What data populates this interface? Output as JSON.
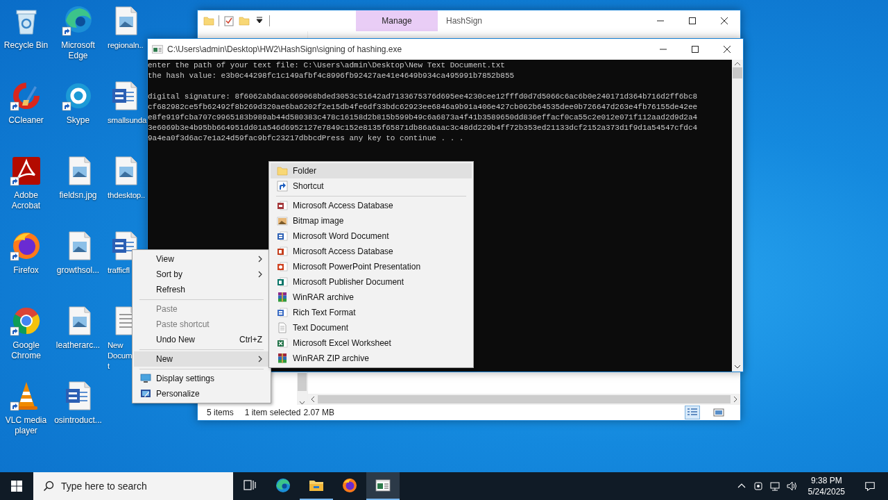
{
  "desktop_columns": [
    {
      "icons": [
        {
          "label": "Recycle Bin",
          "kind": "recycle",
          "shortcut": false
        },
        {
          "label": "CCleaner",
          "kind": "ccleaner",
          "shortcut": true
        },
        {
          "label": "Adobe\nAcrobat",
          "kind": "acrobat",
          "shortcut": true
        },
        {
          "label": "Firefox",
          "kind": "firefox",
          "shortcut": true
        },
        {
          "label": "Google\nChrome",
          "kind": "chrome",
          "shortcut": true
        },
        {
          "label": "VLC media\nplayer",
          "kind": "vlc",
          "shortcut": true
        }
      ]
    },
    {
      "icons": [
        {
          "label": "Microsoft\nEdge",
          "kind": "edge",
          "shortcut": true
        },
        {
          "label": "Skype",
          "kind": "skype",
          "shortcut": true
        },
        {
          "label": "fieldsn.jpg",
          "kind": "image",
          "shortcut": false
        },
        {
          "label": "growthsol...",
          "kind": "image",
          "shortcut": false
        },
        {
          "label": "leatherarc...",
          "kind": "image",
          "shortcut": false
        },
        {
          "label": "osintroduct...",
          "kind": "word",
          "shortcut": false
        }
      ]
    },
    {
      "icons": [
        {
          "label": "regionaln..",
          "kind": "image",
          "shortcut": false
        },
        {
          "label": "smallsunda",
          "kind": "word",
          "shortcut": false
        },
        {
          "label": "thdesktop..",
          "kind": "image",
          "shortcut": false
        },
        {
          "label": "trafficfl",
          "kind": "word",
          "shortcut": false
        },
        {
          "label": "New\nDocum\nt",
          "kind": "text",
          "shortcut": false
        }
      ]
    }
  ],
  "explorer": {
    "context_tab": "Manage",
    "title": "HashSign",
    "status_bar": {
      "item_count": "5 items",
      "selection": "1 item selected",
      "size": "2.07 MB"
    },
    "view_buttons": [
      {
        "kind": "details",
        "selected": true
      },
      {
        "kind": "preview",
        "selected": false
      }
    ]
  },
  "console": {
    "title": "C:\\Users\\admin\\Desktop\\HW2\\HashSign\\signing of hashing.exe",
    "input_lines": [
      "enter the path of your text file: C:\\Users\\admin\\Desktop\\New Text Document.txt",
      "the hash value: e3b0c44298fc1c149afbf4c8996fb92427ae41e4649b934ca495991b7852b855"
    ],
    "signature_lines": [
      "digital signature: 8f6062abdaac669068bded3053c51642ad7133675376d695ee4230cee12fffd0d7d5066c6ac6b0e240171d364b716d2ff6bc8",
      "cf682982ce5fb62492f8b269d320ae6ba6202f2e15db4fe6df33bdc62923ee6846a9b91a406e427cb062b64535dee0b726647d263e4fb76155de42ee",
      "e8fe919fcba707c9965183b989ab44d580383c478c16158d2b815b599b49c6a6873a4f41b3589650dd836effacf0ca55c2e012e071f112aad2d9d2a4",
      "3e6069b3e4b95bb664951dd01a546d6952127e7849c152e8135f65871db86a6aac3c48dd229b4ff72b353ed21133dcf2152a373d1f9d1a54547cfdc4",
      "9a4ea0f3d6ac7e1a24d59fac9bfc23217dbbcdPress any key to continue . . ."
    ]
  },
  "context_menu": {
    "items": [
      {
        "kind": "item",
        "label": "View",
        "has_submenu": true,
        "disabled": false,
        "selected": false
      },
      {
        "kind": "item",
        "label": "Sort by",
        "has_submenu": true,
        "disabled": false,
        "selected": false
      },
      {
        "kind": "item",
        "label": "Refresh",
        "has_submenu": false,
        "disabled": false,
        "selected": false
      },
      {
        "kind": "separator"
      },
      {
        "kind": "item",
        "label": "Paste",
        "has_submenu": false,
        "disabled": true,
        "selected": false
      },
      {
        "kind": "item",
        "label": "Paste shortcut",
        "has_submenu": false,
        "disabled": true,
        "selected": false
      },
      {
        "kind": "item",
        "label": "Undo New",
        "shortcut": "Ctrl+Z",
        "has_submenu": false,
        "disabled": false,
        "selected": false
      },
      {
        "kind": "separator"
      },
      {
        "kind": "item",
        "label": "New",
        "has_submenu": true,
        "disabled": false,
        "selected": true
      },
      {
        "kind": "separator"
      },
      {
        "kind": "display",
        "label": "Display settings",
        "has_submenu": false,
        "disabled": false,
        "selected": false
      },
      {
        "kind": "personalize",
        "label": "Personalize",
        "has_submenu": false,
        "disabled": false,
        "selected": false
      }
    ]
  },
  "new_submenu": {
    "items": [
      {
        "kind": "folder",
        "label": "Folder",
        "selected": true
      },
      {
        "kind": "shortcut",
        "label": "Shortcut",
        "selected": false
      },
      {
        "kind": "separator"
      },
      {
        "kind": "access",
        "label": "Microsoft Access Database",
        "selected": false
      },
      {
        "kind": "bitmap",
        "label": "Bitmap image",
        "selected": false
      },
      {
        "kind": "word",
        "label": "Microsoft Word Document",
        "selected": false
      },
      {
        "kind": "access_alt",
        "label": "Microsoft Access Database",
        "selected": false
      },
      {
        "kind": "powerpoint",
        "label": "Microsoft PowerPoint Presentation",
        "selected": false
      },
      {
        "kind": "publisher",
        "label": "Microsoft Publisher Document",
        "selected": false
      },
      {
        "kind": "winrar",
        "label": "WinRAR archive",
        "selected": false
      },
      {
        "kind": "rtf",
        "label": "Rich Text Format",
        "selected": false
      },
      {
        "kind": "text",
        "label": "Text Document",
        "selected": false
      },
      {
        "kind": "excel",
        "label": "Microsoft Excel Worksheet",
        "selected": false
      },
      {
        "kind": "zip",
        "label": "WinRAR ZIP archive",
        "selected": false
      }
    ]
  },
  "taskbar": {
    "search": {
      "placeholder": "Type here to search"
    },
    "apps": [
      {
        "kind": "taskview",
        "running": false,
        "selected": false
      },
      {
        "kind": "edge",
        "running": false,
        "selected": false
      },
      {
        "kind": "explorer",
        "running": true,
        "selected": false
      },
      {
        "kind": "firefox",
        "running": false,
        "selected": false
      },
      {
        "kind": "console",
        "running": true,
        "selected": true
      }
    ],
    "clock": {
      "time": "9:38 PM",
      "date": "5/24/2025"
    }
  }
}
